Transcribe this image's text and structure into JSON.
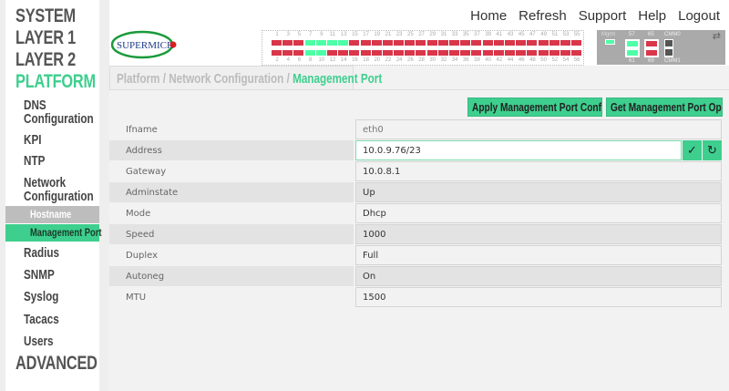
{
  "sidebar": {
    "top": [
      "SYSTEM",
      "LAYER 1",
      "LAYER 2",
      "PLATFORM",
      "ADVANCED"
    ],
    "platform_items": [
      "DNS Configuration",
      "KPI",
      "NTP",
      "Network Configuration",
      "Radius",
      "SNMP",
      "Syslog",
      "Tacacs",
      "Users"
    ],
    "network_sub": [
      "Hostname",
      "Management Port"
    ]
  },
  "topnav": [
    "Home",
    "Refresh",
    "Support",
    "Help",
    "Logout"
  ],
  "logo_text": "SUPERMICRO",
  "ports": {
    "top_labels": [
      "1",
      "3",
      "5",
      "7",
      "9",
      "11",
      "13",
      "15",
      "17",
      "19",
      "21",
      "23",
      "25",
      "27",
      "29",
      "31",
      "33",
      "35",
      "37",
      "39",
      "41",
      "43",
      "45",
      "47",
      "49",
      "51",
      "53",
      "55"
    ],
    "bottom_labels": [
      "2",
      "4",
      "6",
      "8",
      "10",
      "12",
      "14",
      "16",
      "18",
      "20",
      "22",
      "24",
      "26",
      "28",
      "30",
      "32",
      "34",
      "36",
      "38",
      "40",
      "42",
      "44",
      "46",
      "48",
      "50",
      "52",
      "54",
      "56"
    ],
    "top_up": [
      "7",
      "9",
      "11",
      "13"
    ],
    "bottom_up": [
      "8",
      "10"
    ],
    "mgmt_label": "Mgmt",
    "p57": "57",
    "p65": "65",
    "p61": "61",
    "p69": "69",
    "cmm0": "CMM0",
    "cmm1": "CMM1"
  },
  "breadcrumb": {
    "a": "Platform",
    "b": "Network Configuration",
    "c": "Management Port",
    "sep": "/"
  },
  "buttons": {
    "apply": "Apply Management Port Configuration",
    "get": "Get Management Port Operstate"
  },
  "fields": [
    {
      "label": "Ifname",
      "value": "eth0"
    },
    {
      "label": "Address",
      "value": "10.0.9.76/23"
    },
    {
      "label": "Gateway",
      "value": "10.0.8.1"
    },
    {
      "label": "Adminstate",
      "value": "Up"
    },
    {
      "label": "Mode",
      "value": "Dhcp"
    },
    {
      "label": "Speed",
      "value": "1000"
    },
    {
      "label": "Duplex",
      "value": "Full"
    },
    {
      "label": "Autoneg",
      "value": "On"
    },
    {
      "label": "MTU",
      "value": "1500"
    }
  ],
  "colors": {
    "accent": "#3ecf8e",
    "port_down": "#d9364a",
    "port_up": "#4dffa6"
  }
}
